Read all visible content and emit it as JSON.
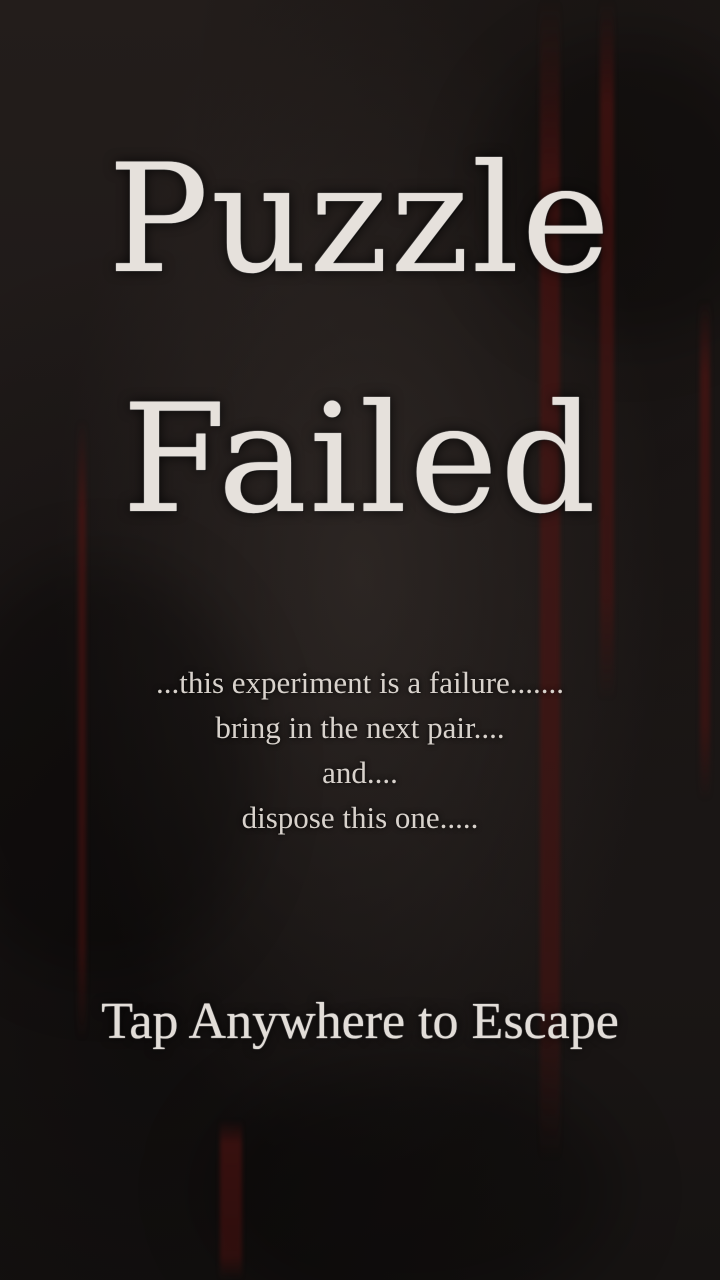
{
  "screen": {
    "title_line1": "Puzzle",
    "title_line2": "Failed",
    "message_lines": [
      "...this experiment is a failure.......",
      "bring in the next pair....",
      "and....",
      "dispose this one....."
    ],
    "escape_prompt": "Tap Anywhere to Escape"
  },
  "colors": {
    "background": "#1c1715",
    "text": "#e6e1dc",
    "streak": "#5a1412"
  }
}
